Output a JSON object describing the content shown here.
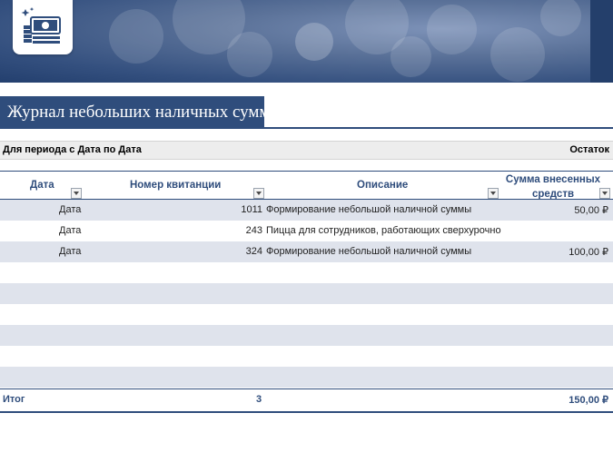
{
  "title": "Журнал небольших наличных сумм",
  "period": {
    "label": "Для периода с Дата по Дата",
    "balance_label": "Остаток"
  },
  "columns": [
    "Дата",
    "Номер квитанции",
    "Описание",
    "Сумма внесенных средств"
  ],
  "rows": [
    {
      "date": "Дата",
      "receipt": "1011",
      "description": "Формирование небольшой наличной суммы",
      "amount": "50,00 ₽"
    },
    {
      "date": "Дата",
      "receipt": "243",
      "description": "Пицца для сотрудников, работающих сверхурочно",
      "amount": ""
    },
    {
      "date": "Дата",
      "receipt": "324",
      "description": "Формирование небольшой наличной суммы",
      "amount": "100,00 ₽"
    }
  ],
  "totals": {
    "label": "Итог",
    "receipt_count": "3",
    "amount": "150,00 ₽"
  },
  "colors": {
    "accent": "#2f4d7c",
    "band": "#dfe3ec"
  },
  "icons": [
    "money-icon"
  ]
}
